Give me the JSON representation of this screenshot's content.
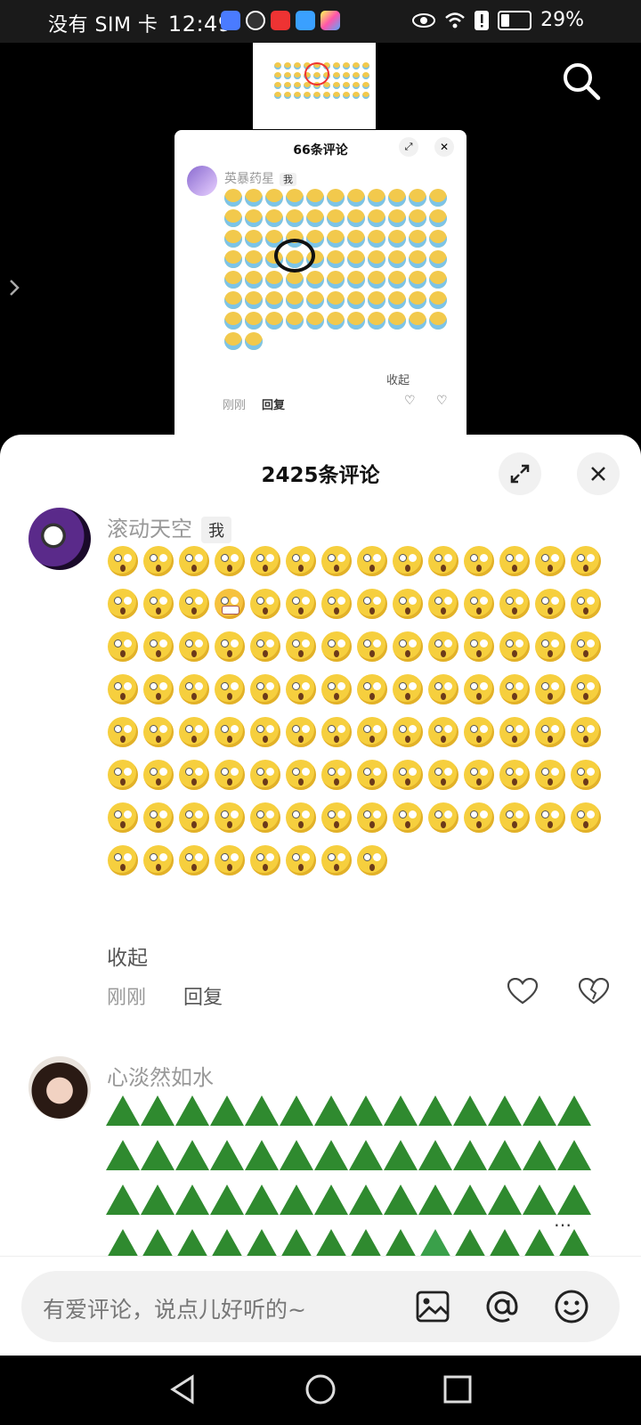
{
  "status_bar": {
    "carrier": "没有 SIM 卡",
    "time": "12:49",
    "battery": "29%",
    "battery_level": 0.29
  },
  "video": {
    "search_icon": "search-icon",
    "popup": {
      "title": "66条评论",
      "username": "英暴药星",
      "me_tag": "我",
      "collapse": "收起",
      "time": "刚刚",
      "reply": "回复"
    }
  },
  "sheet": {
    "title": "2425条评论",
    "comments": [
      {
        "username": "滚动天空",
        "me_tag": "我",
        "collapse": "收起",
        "time": "刚刚",
        "reply": "回复"
      },
      {
        "username": "心淡然如水"
      }
    ]
  },
  "input": {
    "placeholder": "有爱评论，说点儿好听的~"
  },
  "colors": {
    "sheet_bg": "#ffffff",
    "muted_text": "#999999",
    "emoji_yellow": "#f6cf3e",
    "zongzi_green": "#2f8a2f"
  }
}
